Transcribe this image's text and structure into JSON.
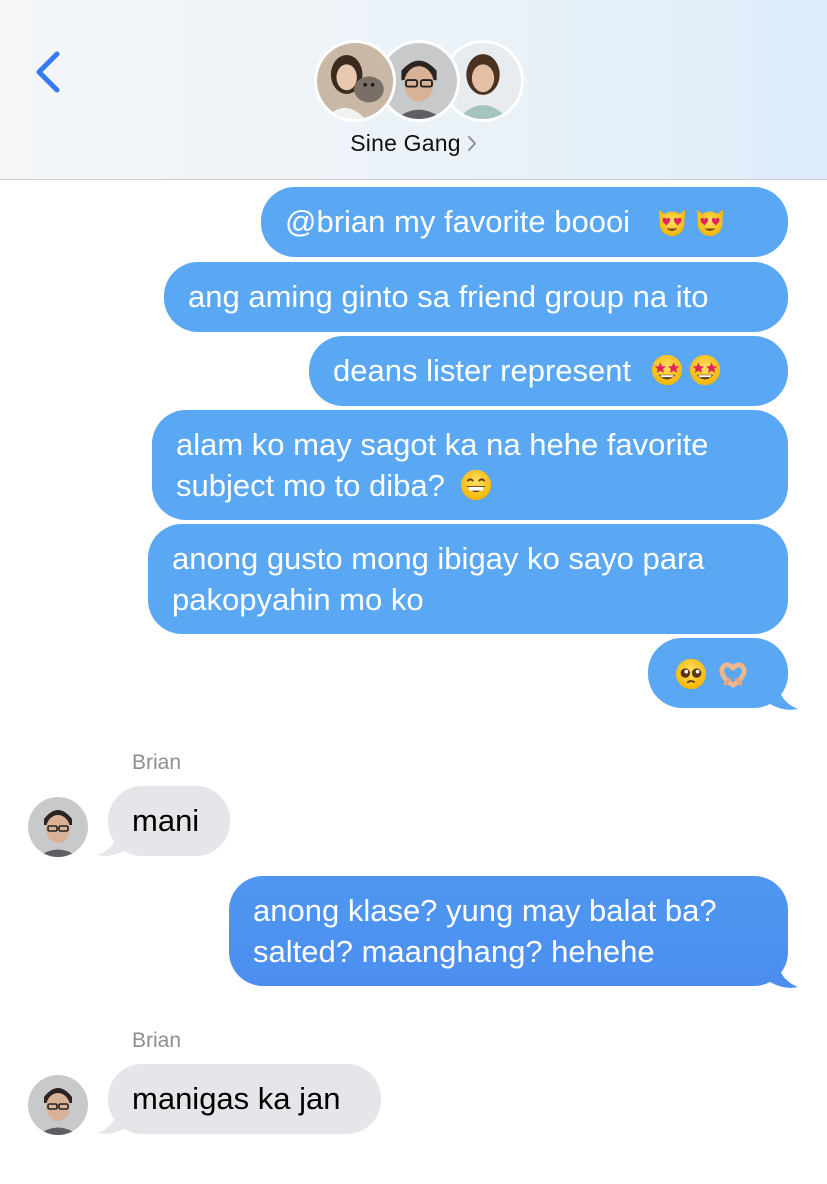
{
  "header": {
    "group_name": "Sine Gang",
    "back_icon": "chevron-left-icon",
    "disclosure_icon": "chevron-right-icon",
    "accent_color": "#3478f6"
  },
  "messages": [
    {
      "from": "me",
      "text": "@brian my favorite boooi",
      "emojis": [
        "heart-eyes-cat",
        "heart-eyes-cat"
      ]
    },
    {
      "from": "me",
      "text": "ang aming ginto sa friend group na ito"
    },
    {
      "from": "me",
      "text": "deans lister represent",
      "emojis": [
        "star-struck",
        "star-struck"
      ]
    },
    {
      "from": "me",
      "text_line1": "alam ko may sagot ka na hehe favorite",
      "text_line2": "subject mo to diba?",
      "emojis": [
        "grinning-face"
      ]
    },
    {
      "from": "me",
      "text_line1": "anong gusto mong ibigay ko sayo para",
      "text_line2": "pakopyahin mo ko"
    },
    {
      "from": "me",
      "emojis": [
        "pleading-face",
        "heart-hands"
      ]
    },
    {
      "from": "Brian",
      "sender": "Brian",
      "text": "mani"
    },
    {
      "from": "me",
      "text_line1": "anong klase? yung may balat ba?",
      "text_line2": "salted? maanghang? hehehe"
    },
    {
      "from": "Brian",
      "sender": "Brian",
      "text": "manigas ka jan"
    }
  ],
  "colors": {
    "sent_bubble": "#5aa8f3",
    "received_bubble": "#e5e5ea",
    "sender_name": "#8e8e93"
  }
}
